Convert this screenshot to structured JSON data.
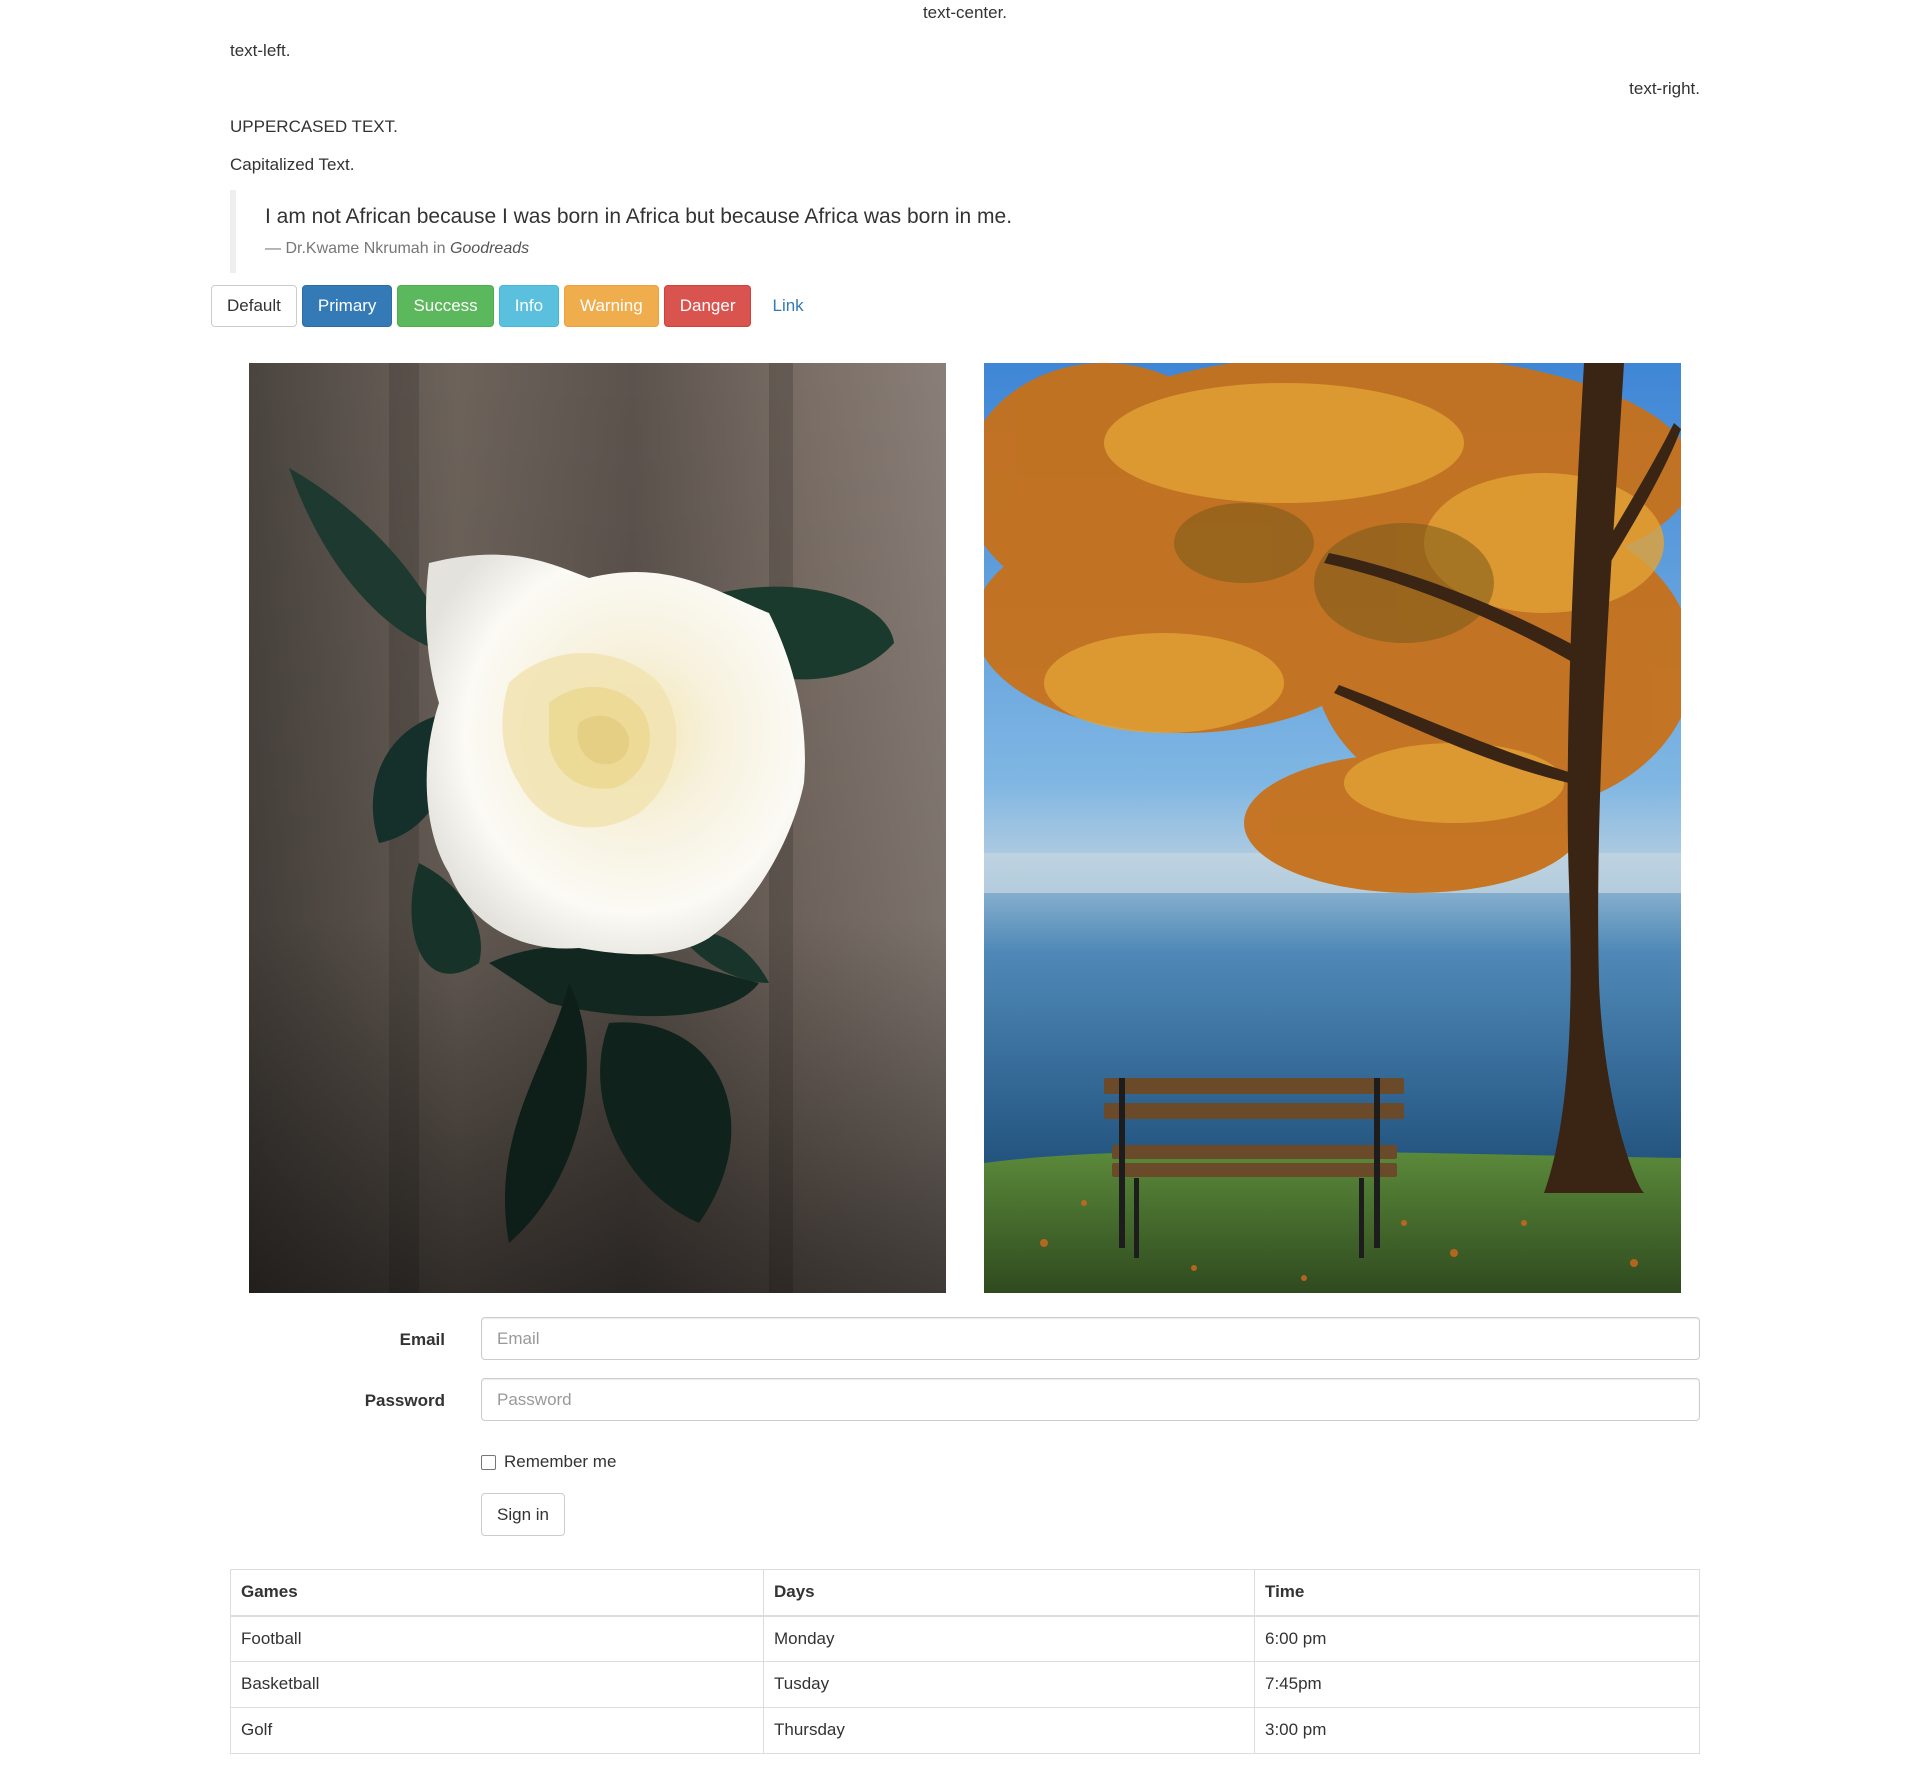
{
  "alignment": {
    "center": "text-center.",
    "left": "text-left.",
    "right": "text-right.",
    "uppercase": "UPPERCASED TEXT.",
    "capitalized": "Capitalized Text."
  },
  "quote": {
    "text": "I am not African because I was born in Africa but because Africa was born in me.",
    "author": "— Dr.Kwame Nkrumah in",
    "source": "Goodreads"
  },
  "buttons": {
    "default": "Default",
    "primary": "Primary",
    "success": "Success",
    "info": "Info",
    "warning": "Warning",
    "danger": "Danger",
    "link": "Link"
  },
  "images": {
    "left": "white-rose-photo",
    "right": "autumn-tree-lake-bench-photo"
  },
  "form": {
    "email_label": "Email",
    "email_placeholder": "Email",
    "email_value": "",
    "password_label": "Password",
    "password_placeholder": "Password",
    "password_value": "",
    "remember_label": "Remember me",
    "remember_checked": false,
    "signin_label": "Sign in"
  },
  "table": {
    "headers": [
      "Games",
      "Days",
      "Time"
    ],
    "rows": [
      [
        "Football",
        "Monday",
        "6:00 pm"
      ],
      [
        "Basketball",
        "Tusday",
        "7:45pm"
      ],
      [
        "Golf",
        "Thursday",
        "3:00 pm"
      ]
    ]
  },
  "colors": {
    "primary": "#337ab7",
    "success": "#5cb85c",
    "info": "#5bc0de",
    "warning": "#f0ad4e",
    "danger": "#d9534f"
  }
}
